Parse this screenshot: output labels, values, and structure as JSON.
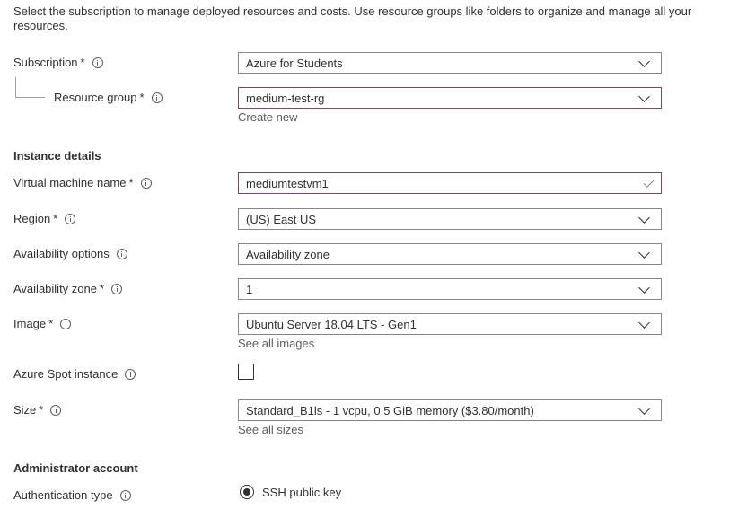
{
  "intro": "Select the subscription to manage deployed resources and costs. Use resource groups like folders to organize and manage all your resources.",
  "fields": {
    "subscription": {
      "label": "Subscription",
      "required": "*",
      "value": "Azure for Students"
    },
    "resource_group": {
      "label": "Resource group",
      "required": "*",
      "value": "medium-test-rg",
      "link": "Create new"
    },
    "vm_name": {
      "label": "Virtual machine name",
      "required": "*",
      "value": "mediumtestvm1"
    },
    "region": {
      "label": "Region",
      "required": "*",
      "value": "(US) East US"
    },
    "availability_options": {
      "label": "Availability options",
      "value": "Availability zone"
    },
    "availability_zone": {
      "label": "Availability zone",
      "required": "*",
      "value": "1"
    },
    "image": {
      "label": "Image",
      "required": "*",
      "value": "Ubuntu Server 18.04 LTS - Gen1",
      "link": "See all images"
    },
    "spot": {
      "label": "Azure Spot instance",
      "checked": false
    },
    "size": {
      "label": "Size",
      "required": "*",
      "value": "Standard_B1ls - 1 vcpu, 0.5 GiB memory ($3.80/month)",
      "link": "See all sizes"
    },
    "auth_type": {
      "label": "Authentication type",
      "option": "SSH public key",
      "selected": true
    }
  },
  "sections": {
    "instance_details": "Instance details",
    "admin_account": "Administrator account"
  },
  "icons": {
    "info": "info-icon",
    "dropdown": "chevron-down-icon",
    "valid": "checkmark-icon"
  },
  "colors": {
    "text": "#323130",
    "border": "#8a8886",
    "focus_border": "#7a4a6e",
    "link": "#605e5c"
  }
}
